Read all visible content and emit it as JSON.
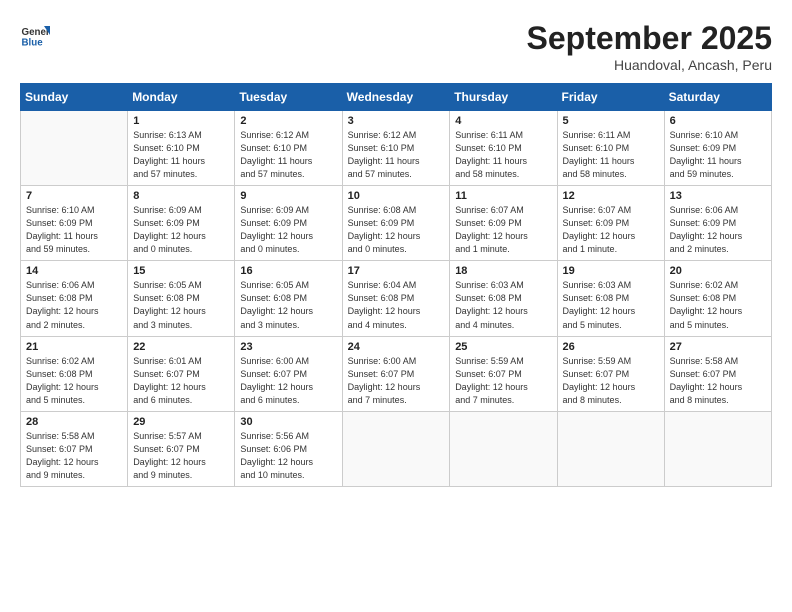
{
  "header": {
    "logo_general": "General",
    "logo_blue": "Blue",
    "month_title": "September 2025",
    "location": "Huandoval, Ancash, Peru"
  },
  "days_of_week": [
    "Sunday",
    "Monday",
    "Tuesday",
    "Wednesday",
    "Thursday",
    "Friday",
    "Saturday"
  ],
  "weeks": [
    [
      {
        "day": "",
        "info": ""
      },
      {
        "day": "1",
        "info": "Sunrise: 6:13 AM\nSunset: 6:10 PM\nDaylight: 11 hours\nand 57 minutes."
      },
      {
        "day": "2",
        "info": "Sunrise: 6:12 AM\nSunset: 6:10 PM\nDaylight: 11 hours\nand 57 minutes."
      },
      {
        "day": "3",
        "info": "Sunrise: 6:12 AM\nSunset: 6:10 PM\nDaylight: 11 hours\nand 57 minutes."
      },
      {
        "day": "4",
        "info": "Sunrise: 6:11 AM\nSunset: 6:10 PM\nDaylight: 11 hours\nand 58 minutes."
      },
      {
        "day": "5",
        "info": "Sunrise: 6:11 AM\nSunset: 6:10 PM\nDaylight: 11 hours\nand 58 minutes."
      },
      {
        "day": "6",
        "info": "Sunrise: 6:10 AM\nSunset: 6:09 PM\nDaylight: 11 hours\nand 59 minutes."
      }
    ],
    [
      {
        "day": "7",
        "info": "Sunrise: 6:10 AM\nSunset: 6:09 PM\nDaylight: 11 hours\nand 59 minutes."
      },
      {
        "day": "8",
        "info": "Sunrise: 6:09 AM\nSunset: 6:09 PM\nDaylight: 12 hours\nand 0 minutes."
      },
      {
        "day": "9",
        "info": "Sunrise: 6:09 AM\nSunset: 6:09 PM\nDaylight: 12 hours\nand 0 minutes."
      },
      {
        "day": "10",
        "info": "Sunrise: 6:08 AM\nSunset: 6:09 PM\nDaylight: 12 hours\nand 0 minutes."
      },
      {
        "day": "11",
        "info": "Sunrise: 6:07 AM\nSunset: 6:09 PM\nDaylight: 12 hours\nand 1 minute."
      },
      {
        "day": "12",
        "info": "Sunrise: 6:07 AM\nSunset: 6:09 PM\nDaylight: 12 hours\nand 1 minute."
      },
      {
        "day": "13",
        "info": "Sunrise: 6:06 AM\nSunset: 6:09 PM\nDaylight: 12 hours\nand 2 minutes."
      }
    ],
    [
      {
        "day": "14",
        "info": "Sunrise: 6:06 AM\nSunset: 6:08 PM\nDaylight: 12 hours\nand 2 minutes."
      },
      {
        "day": "15",
        "info": "Sunrise: 6:05 AM\nSunset: 6:08 PM\nDaylight: 12 hours\nand 3 minutes."
      },
      {
        "day": "16",
        "info": "Sunrise: 6:05 AM\nSunset: 6:08 PM\nDaylight: 12 hours\nand 3 minutes."
      },
      {
        "day": "17",
        "info": "Sunrise: 6:04 AM\nSunset: 6:08 PM\nDaylight: 12 hours\nand 4 minutes."
      },
      {
        "day": "18",
        "info": "Sunrise: 6:03 AM\nSunset: 6:08 PM\nDaylight: 12 hours\nand 4 minutes."
      },
      {
        "day": "19",
        "info": "Sunrise: 6:03 AM\nSunset: 6:08 PM\nDaylight: 12 hours\nand 5 minutes."
      },
      {
        "day": "20",
        "info": "Sunrise: 6:02 AM\nSunset: 6:08 PM\nDaylight: 12 hours\nand 5 minutes."
      }
    ],
    [
      {
        "day": "21",
        "info": "Sunrise: 6:02 AM\nSunset: 6:08 PM\nDaylight: 12 hours\nand 5 minutes."
      },
      {
        "day": "22",
        "info": "Sunrise: 6:01 AM\nSunset: 6:07 PM\nDaylight: 12 hours\nand 6 minutes."
      },
      {
        "day": "23",
        "info": "Sunrise: 6:00 AM\nSunset: 6:07 PM\nDaylight: 12 hours\nand 6 minutes."
      },
      {
        "day": "24",
        "info": "Sunrise: 6:00 AM\nSunset: 6:07 PM\nDaylight: 12 hours\nand 7 minutes."
      },
      {
        "day": "25",
        "info": "Sunrise: 5:59 AM\nSunset: 6:07 PM\nDaylight: 12 hours\nand 7 minutes."
      },
      {
        "day": "26",
        "info": "Sunrise: 5:59 AM\nSunset: 6:07 PM\nDaylight: 12 hours\nand 8 minutes."
      },
      {
        "day": "27",
        "info": "Sunrise: 5:58 AM\nSunset: 6:07 PM\nDaylight: 12 hours\nand 8 minutes."
      }
    ],
    [
      {
        "day": "28",
        "info": "Sunrise: 5:58 AM\nSunset: 6:07 PM\nDaylight: 12 hours\nand 9 minutes."
      },
      {
        "day": "29",
        "info": "Sunrise: 5:57 AM\nSunset: 6:07 PM\nDaylight: 12 hours\nand 9 minutes."
      },
      {
        "day": "30",
        "info": "Sunrise: 5:56 AM\nSunset: 6:06 PM\nDaylight: 12 hours\nand 10 minutes."
      },
      {
        "day": "",
        "info": ""
      },
      {
        "day": "",
        "info": ""
      },
      {
        "day": "",
        "info": ""
      },
      {
        "day": "",
        "info": ""
      }
    ]
  ]
}
